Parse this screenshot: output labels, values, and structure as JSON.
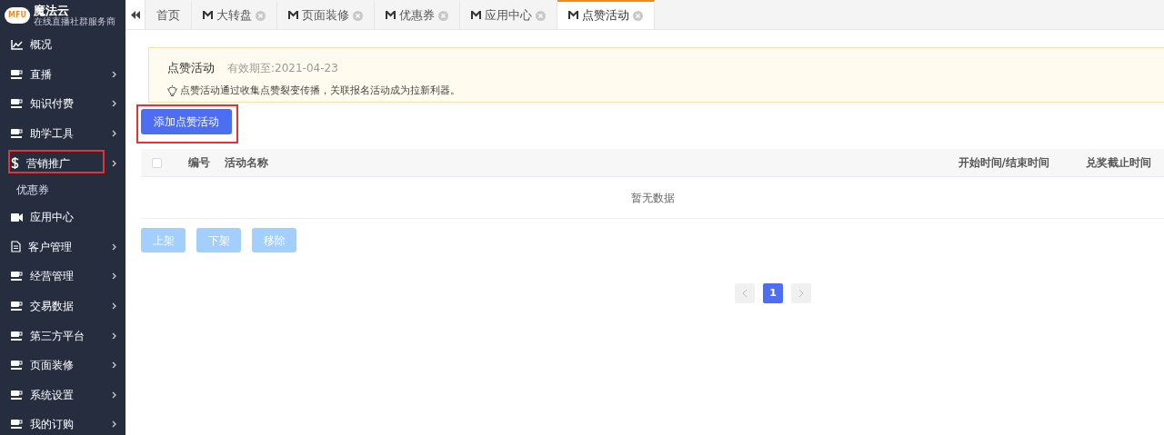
{
  "sidebar": {
    "logo": {
      "badge": "MFU",
      "title": "魔法云",
      "subtitle": "在线直播社群服务商"
    },
    "items": [
      {
        "label": "概况",
        "kind": "chart",
        "expandable": false,
        "highlighted": false
      },
      {
        "label": "直播",
        "kind": "cup",
        "expandable": true,
        "highlighted": false
      },
      {
        "label": "知识付费",
        "kind": "cup",
        "expandable": true,
        "highlighted": false
      },
      {
        "label": "助学工具",
        "kind": "cup",
        "expandable": true,
        "highlighted": false
      },
      {
        "label": "营销推广",
        "kind": "dollar",
        "expandable": true,
        "highlighted": true
      },
      {
        "label": "优惠券",
        "kind": "sub",
        "expandable": false,
        "highlighted": false
      },
      {
        "label": "应用中心",
        "kind": "camera",
        "expandable": false,
        "highlighted": false
      },
      {
        "label": "客户管理",
        "kind": "doc",
        "expandable": true,
        "highlighted": false
      },
      {
        "label": "经营管理",
        "kind": "cup",
        "expandable": true,
        "highlighted": false
      },
      {
        "label": "交易数据",
        "kind": "cup",
        "expandable": true,
        "highlighted": false
      },
      {
        "label": "第三方平台",
        "kind": "cup",
        "expandable": true,
        "highlighted": false
      },
      {
        "label": "页面装修",
        "kind": "cup",
        "expandable": true,
        "highlighted": false
      },
      {
        "label": "系统设置",
        "kind": "cup",
        "expandable": true,
        "highlighted": false
      },
      {
        "label": "我的订购",
        "kind": "cup",
        "expandable": true,
        "highlighted": false
      }
    ]
  },
  "tabs": [
    {
      "label": "首页",
      "kind": "home",
      "selected": false
    },
    {
      "label": "大转盘",
      "kind": "page",
      "selected": false
    },
    {
      "label": "页面装修",
      "kind": "page",
      "selected": false
    },
    {
      "label": "优惠券",
      "kind": "page",
      "selected": false
    },
    {
      "label": "应用中心",
      "kind": "page",
      "selected": false
    },
    {
      "label": "点赞活动",
      "kind": "page",
      "selected": true
    }
  ],
  "notice": {
    "title": "点赞活动",
    "validity": "有效期至:2021-04-23",
    "tip": "点赞活动通过收集点赞裂变传播，关联报名活动成为拉新利器。"
  },
  "add_button": {
    "label": "添加点赞活动",
    "highlighted": true
  },
  "table": {
    "select_all": {
      "checked": false
    },
    "columns": [
      "编号",
      "活动名称",
      "开始时间/结束时间",
      "兑奖截止时间"
    ],
    "empty_text": "暂无数据"
  },
  "actions": [
    {
      "label": "上架",
      "disabled": true
    },
    {
      "label": "下架",
      "disabled": true
    },
    {
      "label": "移除",
      "disabled": true
    }
  ],
  "pagination": {
    "prev": {
      "disabled": true
    },
    "pages": [
      {
        "label": "1",
        "selected": true
      }
    ],
    "next": {
      "disabled": true
    }
  }
}
